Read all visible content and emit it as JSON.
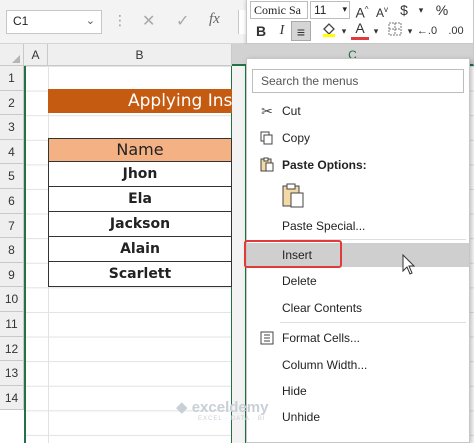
{
  "formula_bar": {
    "name_box": "C1",
    "cancel_glyph": "✕",
    "enter_glyph": "✓",
    "fx_label": "fx"
  },
  "mini_toolbar": {
    "font": "Comic Sa",
    "size": "11",
    "bold": "B",
    "italic": "I",
    "percent": "%"
  },
  "columns": [
    "A",
    "B",
    "C"
  ],
  "rows": [
    "1",
    "2",
    "3",
    "4",
    "5",
    "6",
    "7",
    "8",
    "9",
    "10",
    "11",
    "12",
    "13",
    "14"
  ],
  "sheet": {
    "title": "Applying Ins",
    "header": "Name",
    "names": [
      "Jhon",
      "Ela",
      "Jackson",
      "Alain",
      "Scarlett"
    ]
  },
  "context_menu": {
    "search_placeholder": "Search the menus",
    "cut": "Cut",
    "copy": "Copy",
    "paste_options": "Paste Options:",
    "paste_special": "Paste Special...",
    "insert": "Insert",
    "delete": "Delete",
    "clear_contents": "Clear Contents",
    "format_cells": "Format Cells...",
    "column_width": "Column Width...",
    "hide": "Hide",
    "unhide": "Unhide"
  },
  "colors": {
    "title_fill": "#c55a11",
    "header_fill": "#f4b183",
    "selection_green": "#217346",
    "highlight_red": "#e03a3a"
  },
  "watermark": {
    "brand": "exceldemy",
    "tagline": "EXCEL · DATA · BI"
  }
}
